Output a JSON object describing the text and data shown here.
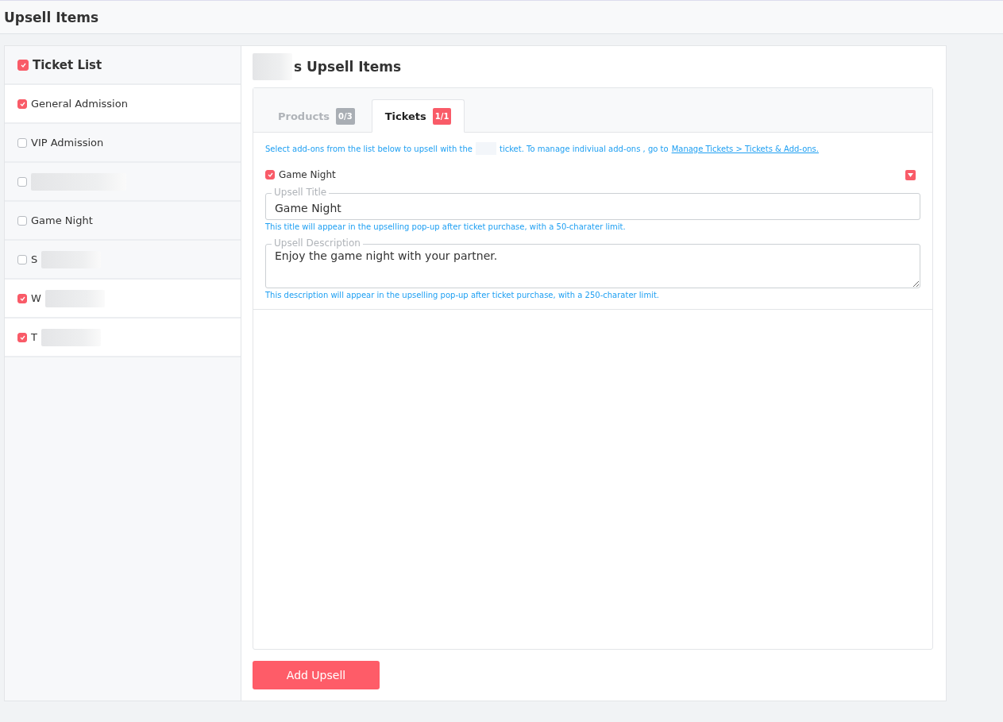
{
  "page_title": "Upsell Items",
  "ticket_list": {
    "header": {
      "label": "Ticket List",
      "checked": true
    },
    "items": [
      {
        "label": "General Admission",
        "checked": true,
        "redacted": false
      },
      {
        "label": "VIP Admission",
        "checked": false,
        "redacted": false
      },
      {
        "checked": false,
        "redacted": true
      },
      {
        "label": "Game Night",
        "checked": false,
        "redacted": false
      },
      {
        "label": "S",
        "checked": false,
        "redacted": true
      },
      {
        "label": "W",
        "checked": true,
        "redacted": true
      },
      {
        "label": "T",
        "checked": true,
        "redacted": true
      }
    ]
  },
  "panel": {
    "title": "s Upsell Items",
    "title_redacted": true,
    "tabs": [
      {
        "label": "Products",
        "count": "0/3",
        "selected": false
      },
      {
        "label": "Tickets",
        "count": "1/1",
        "selected": true
      }
    ],
    "intro_before": "Select add-ons from the list below to upsell with the",
    "intro_after": "ticket. To manage indiviual add-ons , go to",
    "intro_link": "Manage Tickets > Tickets & Add-ons.",
    "addons": [
      {
        "label": "Game Night",
        "checked": true,
        "expanded": true,
        "title_label": "Upsell Title",
        "title_value": "Game Night",
        "title_hint": "This title will appear in the upselling pop-up after ticket purchase, with a 50-charater limit.",
        "description_label": "Upsell Description",
        "description_value": "Enjoy the game night with your partner.",
        "description_hint": "This description will appear in the upselling pop-up after ticket purchase, with a 250-charater limit."
      }
    ],
    "button": "Add Upsell"
  }
}
